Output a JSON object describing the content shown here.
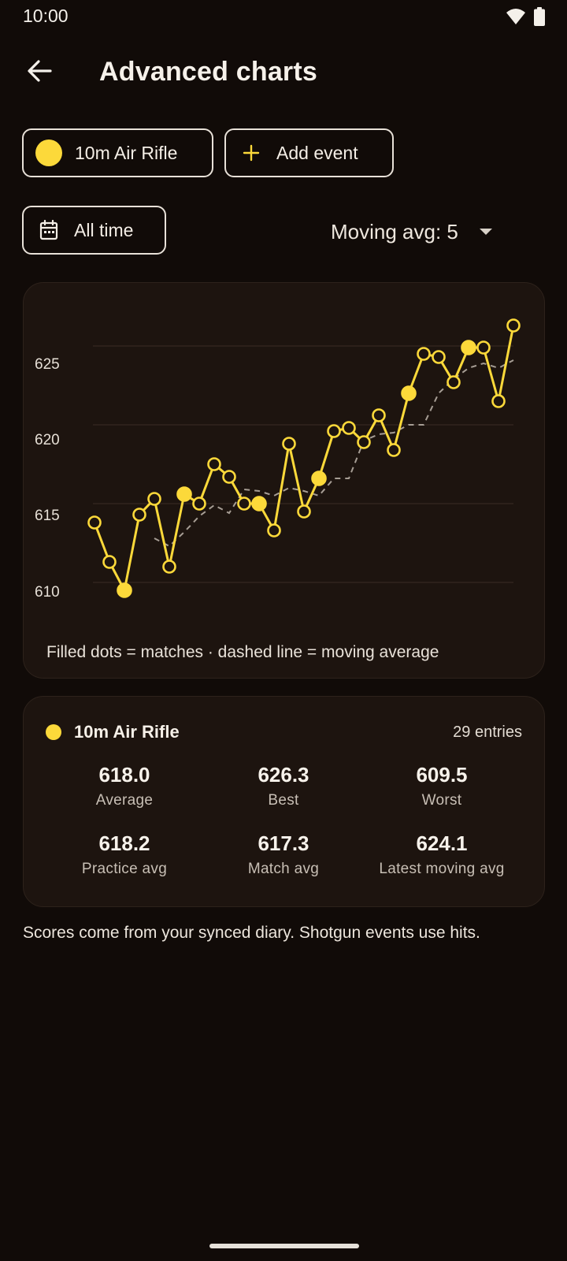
{
  "status_bar": {
    "time": "10:00",
    "icons": [
      "wifi-icon",
      "battery-icon"
    ]
  },
  "header": {
    "title": "Advanced charts",
    "back_icon": "arrow-left-icon"
  },
  "filters": {
    "event_chip": {
      "label": "10m Air Rifle",
      "color": "#fcd93a"
    },
    "add_event_chip": {
      "label": "Add event",
      "icon": "plus-icon"
    },
    "time_chip": {
      "label": "All time",
      "icon": "calendar-icon"
    },
    "moving_avg": {
      "label": "Moving avg: 5",
      "icon": "dropdown-arrow-icon"
    }
  },
  "chart": {
    "caption": "Filled dots = matches · dashed line = moving average",
    "accent": "#fcd93a",
    "avg_color": "#a69d94"
  },
  "chart_data": {
    "type": "line",
    "title": "",
    "xlabel": "",
    "ylabel": "",
    "y_ticks": [
      "610",
      "615",
      "620",
      "625"
    ],
    "ylim": [
      608,
      628
    ],
    "grid": true,
    "series": [
      {
        "role": "scores",
        "values": [
          613.8,
          611.3,
          609.5,
          614.3,
          615.3,
          611.0,
          615.6,
          615.0,
          617.5,
          616.7,
          615.0,
          615.0,
          613.3,
          618.8,
          614.5,
          616.6,
          619.6,
          619.8,
          618.9,
          620.6,
          618.4,
          622.0,
          624.5,
          624.3,
          622.7,
          624.9,
          624.9,
          621.5,
          626.3
        ],
        "matches": [
          false,
          false,
          true,
          false,
          false,
          false,
          true,
          false,
          false,
          false,
          false,
          true,
          false,
          false,
          false,
          true,
          false,
          false,
          false,
          false,
          false,
          true,
          false,
          false,
          false,
          true,
          false,
          false,
          false
        ]
      },
      {
        "role": "moving average",
        "values": [
          null,
          null,
          null,
          null,
          612.8,
          612.3,
          613.2,
          614.2,
          614.9,
          614.4,
          615.9,
          615.8,
          615.5,
          616.0,
          615.8,
          615.5,
          616.6,
          616.6,
          619.0,
          619.4,
          619.5,
          620.0,
          620.0,
          622.0,
          622.9,
          623.6,
          623.9,
          623.6,
          624.1
        ]
      }
    ]
  },
  "stats": {
    "event": "10m Air Rifle",
    "entries": "29 entries",
    "items": [
      {
        "value": "618.0",
        "label": "Average"
      },
      {
        "value": "626.3",
        "label": "Best"
      },
      {
        "value": "609.5",
        "label": "Worst"
      },
      {
        "value": "618.2",
        "label": "Practice avg"
      },
      {
        "value": "617.3",
        "label": "Match avg"
      },
      {
        "value": "624.1",
        "label": "Latest moving avg"
      }
    ]
  },
  "footnote": "Scores come from your synced diary. Shotgun events use hits."
}
